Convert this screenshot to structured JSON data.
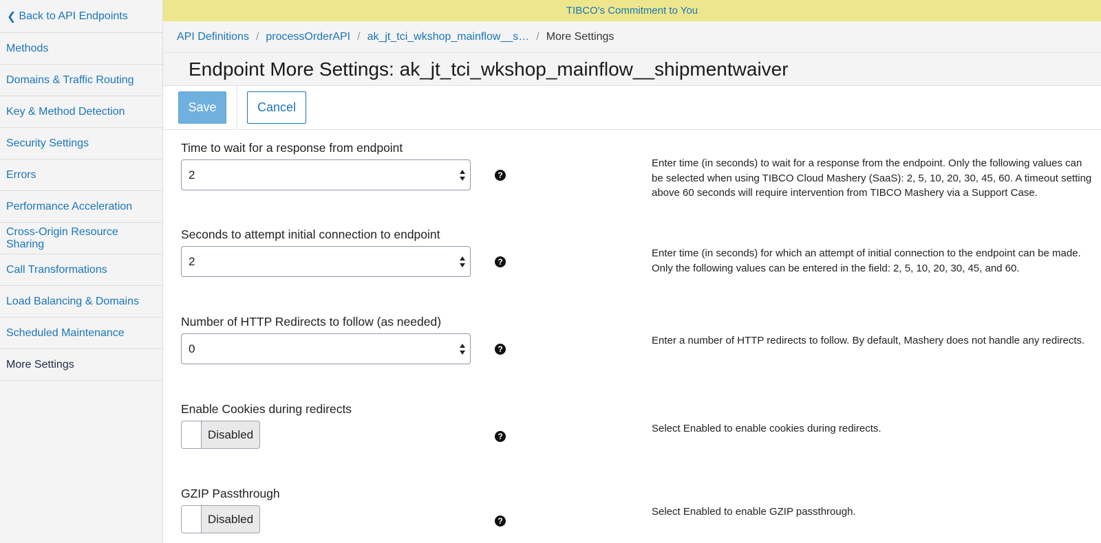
{
  "sidebar": {
    "back_label": "Back to API Endpoints",
    "items": [
      {
        "label": "Methods"
      },
      {
        "label": "Domains & Traffic Routing"
      },
      {
        "label": "Key & Method Detection"
      },
      {
        "label": "Security Settings"
      },
      {
        "label": "Errors"
      },
      {
        "label": "Performance Acceleration"
      },
      {
        "label": "Cross-Origin Resource Sharing"
      },
      {
        "label": "Call Transformations"
      },
      {
        "label": "Load Balancing & Domains"
      },
      {
        "label": "Scheduled Maintenance"
      },
      {
        "label": "More Settings",
        "active": true
      }
    ]
  },
  "banner": {
    "text": "TIBCO's Commitment to You"
  },
  "breadcrumb": {
    "items": [
      "API Definitions",
      "processOrderAPI",
      "ak_jt_tci_wkshop_mainflow__s…",
      "More Settings"
    ],
    "separator": "/"
  },
  "page": {
    "title": "Endpoint More Settings: ak_jt_tci_wkshop_mainflow__shipmentwaiver"
  },
  "toolbar": {
    "save_label": "Save",
    "cancel_label": "Cancel"
  },
  "settings": [
    {
      "label": "Time to wait for a response from endpoint",
      "type": "select",
      "value": "2",
      "description": "Enter time (in seconds) to wait for a response from the endpoint. Only the following values can be selected when using TIBCO Cloud Mashery (SaaS): 2, 5, 10, 20, 30, 45, 60. A timeout setting above 60 seconds will require intervention from TIBCO Mashery via a Support Case."
    },
    {
      "label": "Seconds to attempt initial connection to endpoint",
      "type": "select",
      "value": "2",
      "description": "Enter time (in seconds) for which an attempt of initial connection to the endpoint can be made. Only the following values can be entered in the field: 2, 5, 10, 20, 30, 45, and 60."
    },
    {
      "label": "Number of HTTP Redirects to follow (as needed)",
      "type": "select",
      "value": "0",
      "description": "Enter a number of HTTP redirects to follow. By default, Mashery does not handle any redirects."
    },
    {
      "label": "Enable Cookies during redirects",
      "type": "toggle",
      "value": "Disabled",
      "description": "Select Enabled to enable cookies during redirects."
    },
    {
      "label": "GZIP Passthrough",
      "type": "toggle",
      "value": "Disabled",
      "description": "Select Enabled to enable GZIP passthrough."
    }
  ],
  "icons": {
    "help": "question-circle-icon",
    "back": "chevron-left-icon",
    "select": "sort-arrows-icon"
  },
  "colors": {
    "link": "#1b75bb",
    "banner_bg": "#ede68c",
    "save_bg": "#6fb0de",
    "sidebar_bg": "#f4f4f4"
  }
}
